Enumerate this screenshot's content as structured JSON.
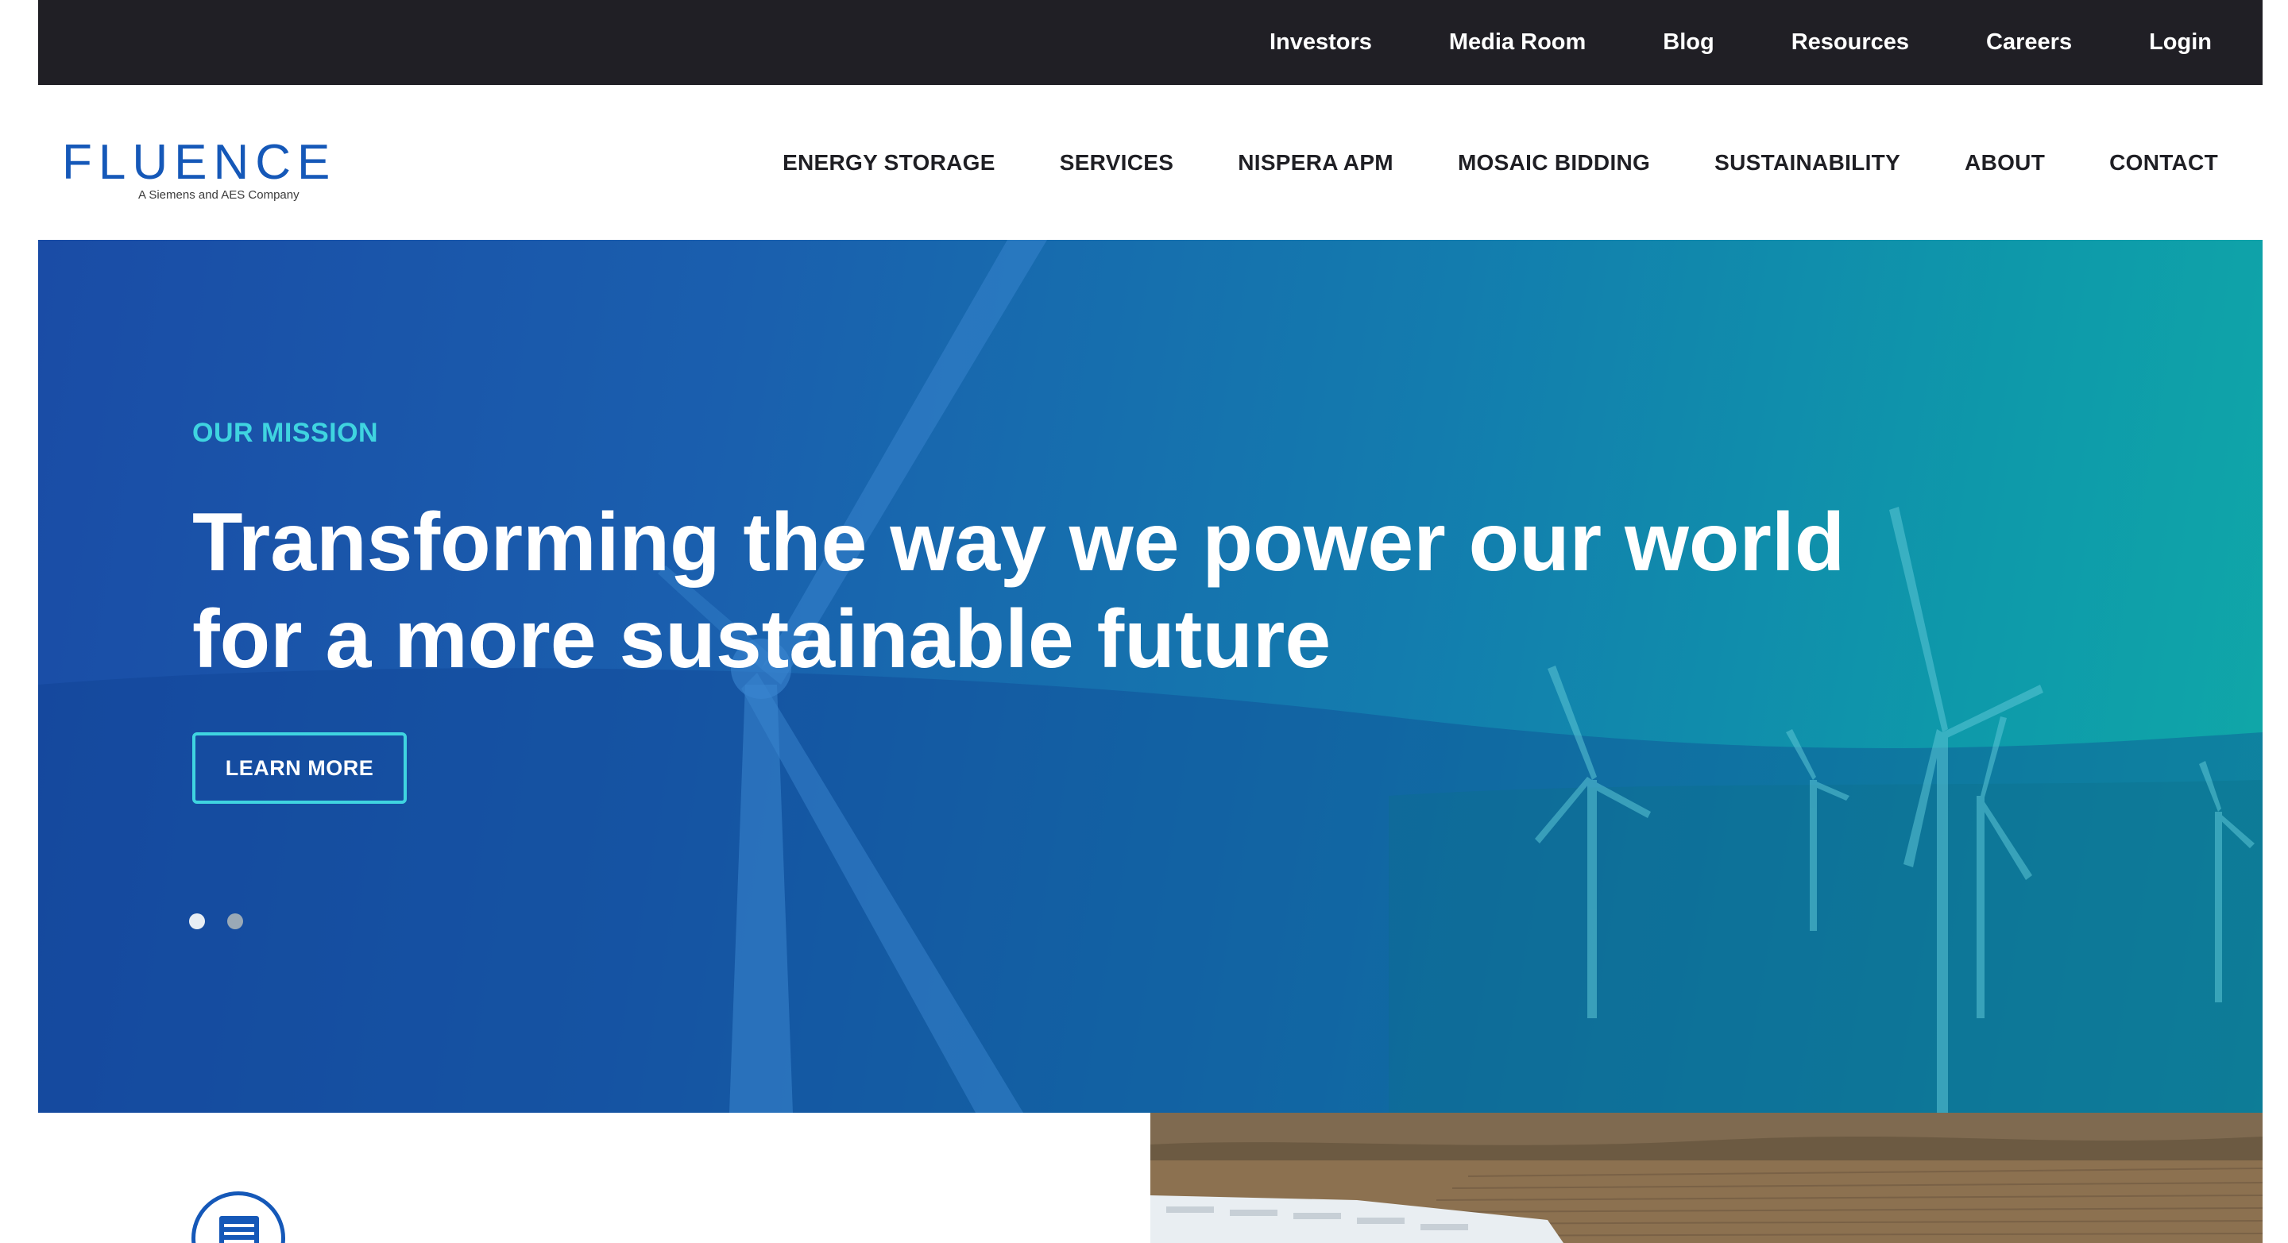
{
  "utility_nav": {
    "items": [
      "Investors",
      "Media Room",
      "Blog",
      "Resources",
      "Careers",
      "Login"
    ]
  },
  "header": {
    "logo_text": "FLUENCE",
    "logo_subtitle": "A Siemens and AES Company",
    "nav": [
      "ENERGY STORAGE",
      "SERVICES",
      "NISPERA APM",
      "MOSAIC BIDDING",
      "SUSTAINABILITY",
      "ABOUT",
      "CONTACT"
    ]
  },
  "hero": {
    "eyebrow": "OUR MISSION",
    "title_line1": "Transforming the way we power our world",
    "title_line2": "for a more sustainable future",
    "cta_label": "LEARN MORE",
    "slides_total": 2,
    "active_slide": 1
  },
  "colors": {
    "utility_bar": "#201f25",
    "brand_blue": "#1558b8",
    "accent_cyan": "#3fd4e0",
    "hero_gradient_start": "#1a4ca6",
    "hero_gradient_end": "#10a9a8"
  },
  "icons": {
    "feature_icon": "battery-storage-icon"
  }
}
